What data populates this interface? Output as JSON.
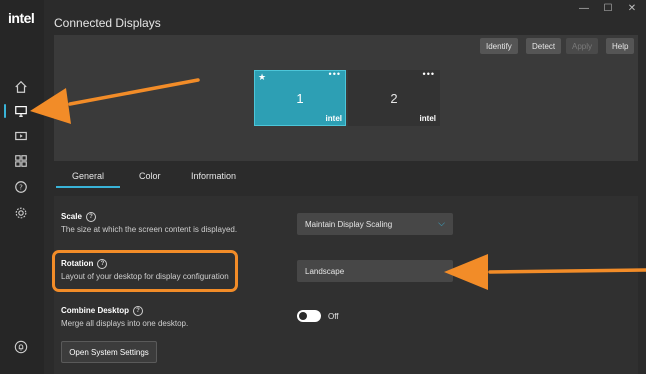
{
  "app": {
    "logo": "intel"
  },
  "window": {
    "min": "—",
    "max": "☐",
    "close": "✕"
  },
  "sidebar": {
    "items": [
      {
        "icon": "home-icon"
      },
      {
        "icon": "display-icon",
        "active": true
      },
      {
        "icon": "video-icon"
      },
      {
        "icon": "apps-grid-icon"
      },
      {
        "icon": "help-icon"
      },
      {
        "icon": "settings-gear-icon"
      },
      {
        "icon": "notification-bell-icon"
      }
    ]
  },
  "header": {
    "title": "Connected Displays"
  },
  "toolbar": {
    "identify": "Identify",
    "detect": "Detect",
    "apply": "Apply",
    "help": "Help"
  },
  "displays": [
    {
      "number": "1",
      "brand": "intel",
      "selected": true,
      "primary_star": "★",
      "menu": "•••"
    },
    {
      "number": "2",
      "brand": "intel",
      "selected": false,
      "menu": "•••"
    }
  ],
  "tabs": [
    {
      "label": "General",
      "active": true
    },
    {
      "label": "Color",
      "active": false
    },
    {
      "label": "Information",
      "active": false
    }
  ],
  "settings": {
    "scale": {
      "title": "Scale",
      "description": "The size at which the screen content is displayed.",
      "value": "Maintain Display Scaling"
    },
    "rotation": {
      "title": "Rotation",
      "description": "Layout of your desktop for display configuration",
      "value": "Landscape"
    },
    "combine": {
      "title": "Combine Desktop",
      "description": "Merge all displays into one desktop.",
      "toggle_label": "Off"
    },
    "open_system_settings": "Open System Settings"
  },
  "colors": {
    "accent": "#39b3d7",
    "annotation": "#f28c28",
    "selected_display": "#2d9fb4"
  }
}
